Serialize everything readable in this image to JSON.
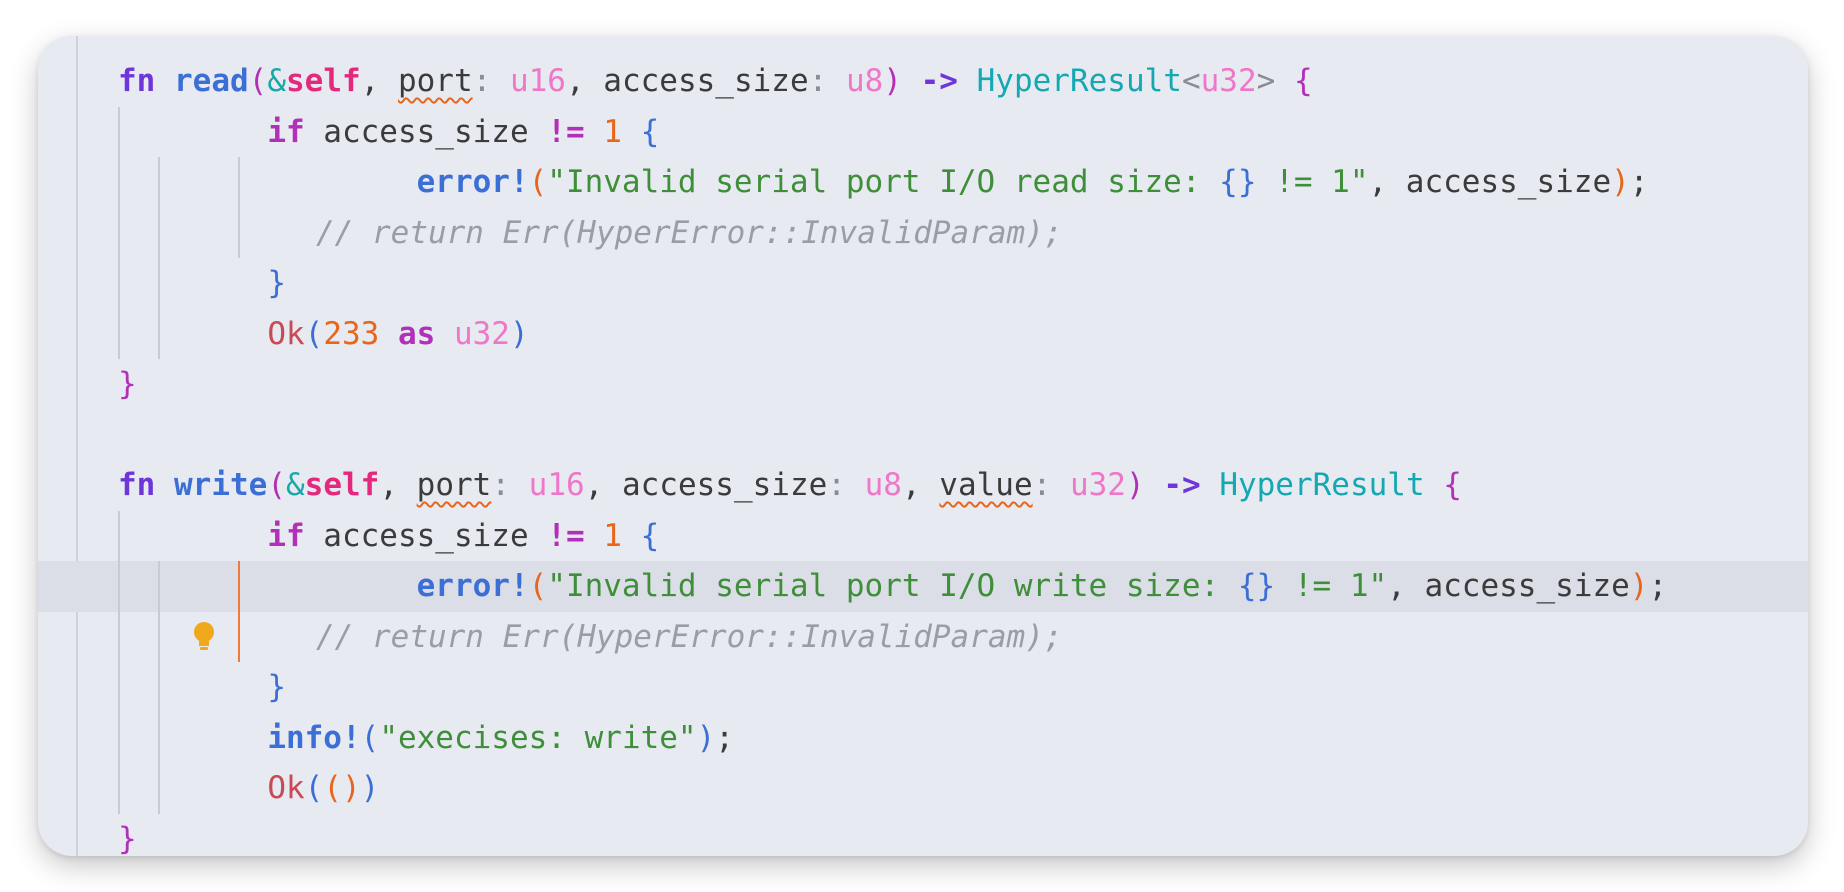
{
  "code_lines": [
    "fn read(&self, port: u16, access_size: u8) -> HyperResult<u32> {",
    "if access_size != 1 {",
    "error!(\"Invalid serial port I/O read size: {} != 1\", access_size);",
    "// return Err(HyperError::InvalidParam);",
    "}",
    "Ok(233 as u32)",
    "}",
    "",
    "fn write(&self, port: u16, access_size: u8, value: u32) -> HyperResult {",
    "if access_size != 1 {",
    "error!(\"Invalid serial port I/O write size: {} != 1\", access_size);",
    "// return Err(HyperError::InvalidParam);",
    "}",
    "info!(\"execises: write\");",
    "Ok(())",
    "}"
  ],
  "current_line_index": 10,
  "gutter_hint_icon": "lightbulb-icon",
  "warning_words": [
    "port",
    "port",
    "value"
  ],
  "colors": {
    "editor_bg": "#e8eaf2",
    "current_line_bg": "#dcdee7",
    "keyword": "#6e35d9",
    "function": "#3b6fd6",
    "self": "#e3287d",
    "type": "#ee77c8",
    "type_name": "#14a8b2",
    "number": "#e8661c",
    "string": "#3f8f3a",
    "comment": "#9a9ca6",
    "lightbulb": "#f0a81c",
    "warning_underline": "#e8661c"
  }
}
